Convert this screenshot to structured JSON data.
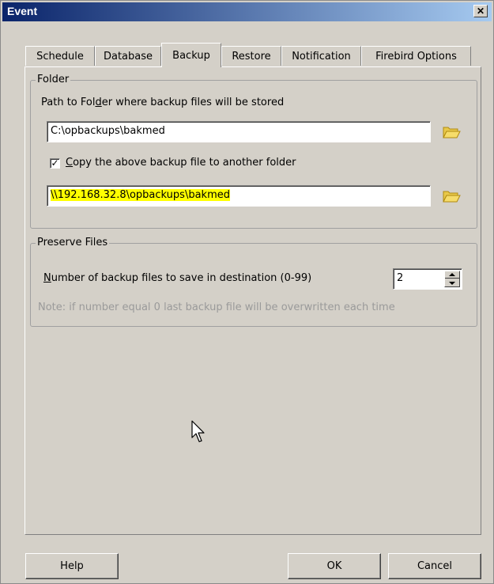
{
  "window": {
    "title": "Event",
    "close_glyph": "✕"
  },
  "tabs": [
    {
      "label": "Schedule"
    },
    {
      "label": "Database"
    },
    {
      "label": "Backup"
    },
    {
      "label": "Restore"
    },
    {
      "label": "Notification"
    },
    {
      "label": "Firebird Options"
    }
  ],
  "active_tab": "Backup",
  "folder_group": {
    "legend": "Folder",
    "path_label_pre": "Path to Fol",
    "path_label_u": "d",
    "path_label_post": "er where backup files will be stored",
    "path_value": "C:\\opbackups\\bakmed",
    "copy_checked": true,
    "copy_label_u": "C",
    "copy_label_rest": "opy the above backup file to another folder",
    "copy_path_value": "\\\\192.168.32.8\\opbackups\\bakmed",
    "folder_icon": "folder-open-icon"
  },
  "preserve_group": {
    "legend": "Preserve Files",
    "count_label_u": "N",
    "count_label_rest": "umber of backup files to save in destination (0-99)",
    "count_value": "2",
    "note": "Note:  if number equal 0 last backup file will be overwritten each time"
  },
  "buttons": {
    "help": "Help",
    "ok": "OK",
    "cancel": "Cancel"
  },
  "colors": {
    "highlight": "#ffff00",
    "title_start": "#0a246a",
    "title_end": "#a6caf0"
  }
}
